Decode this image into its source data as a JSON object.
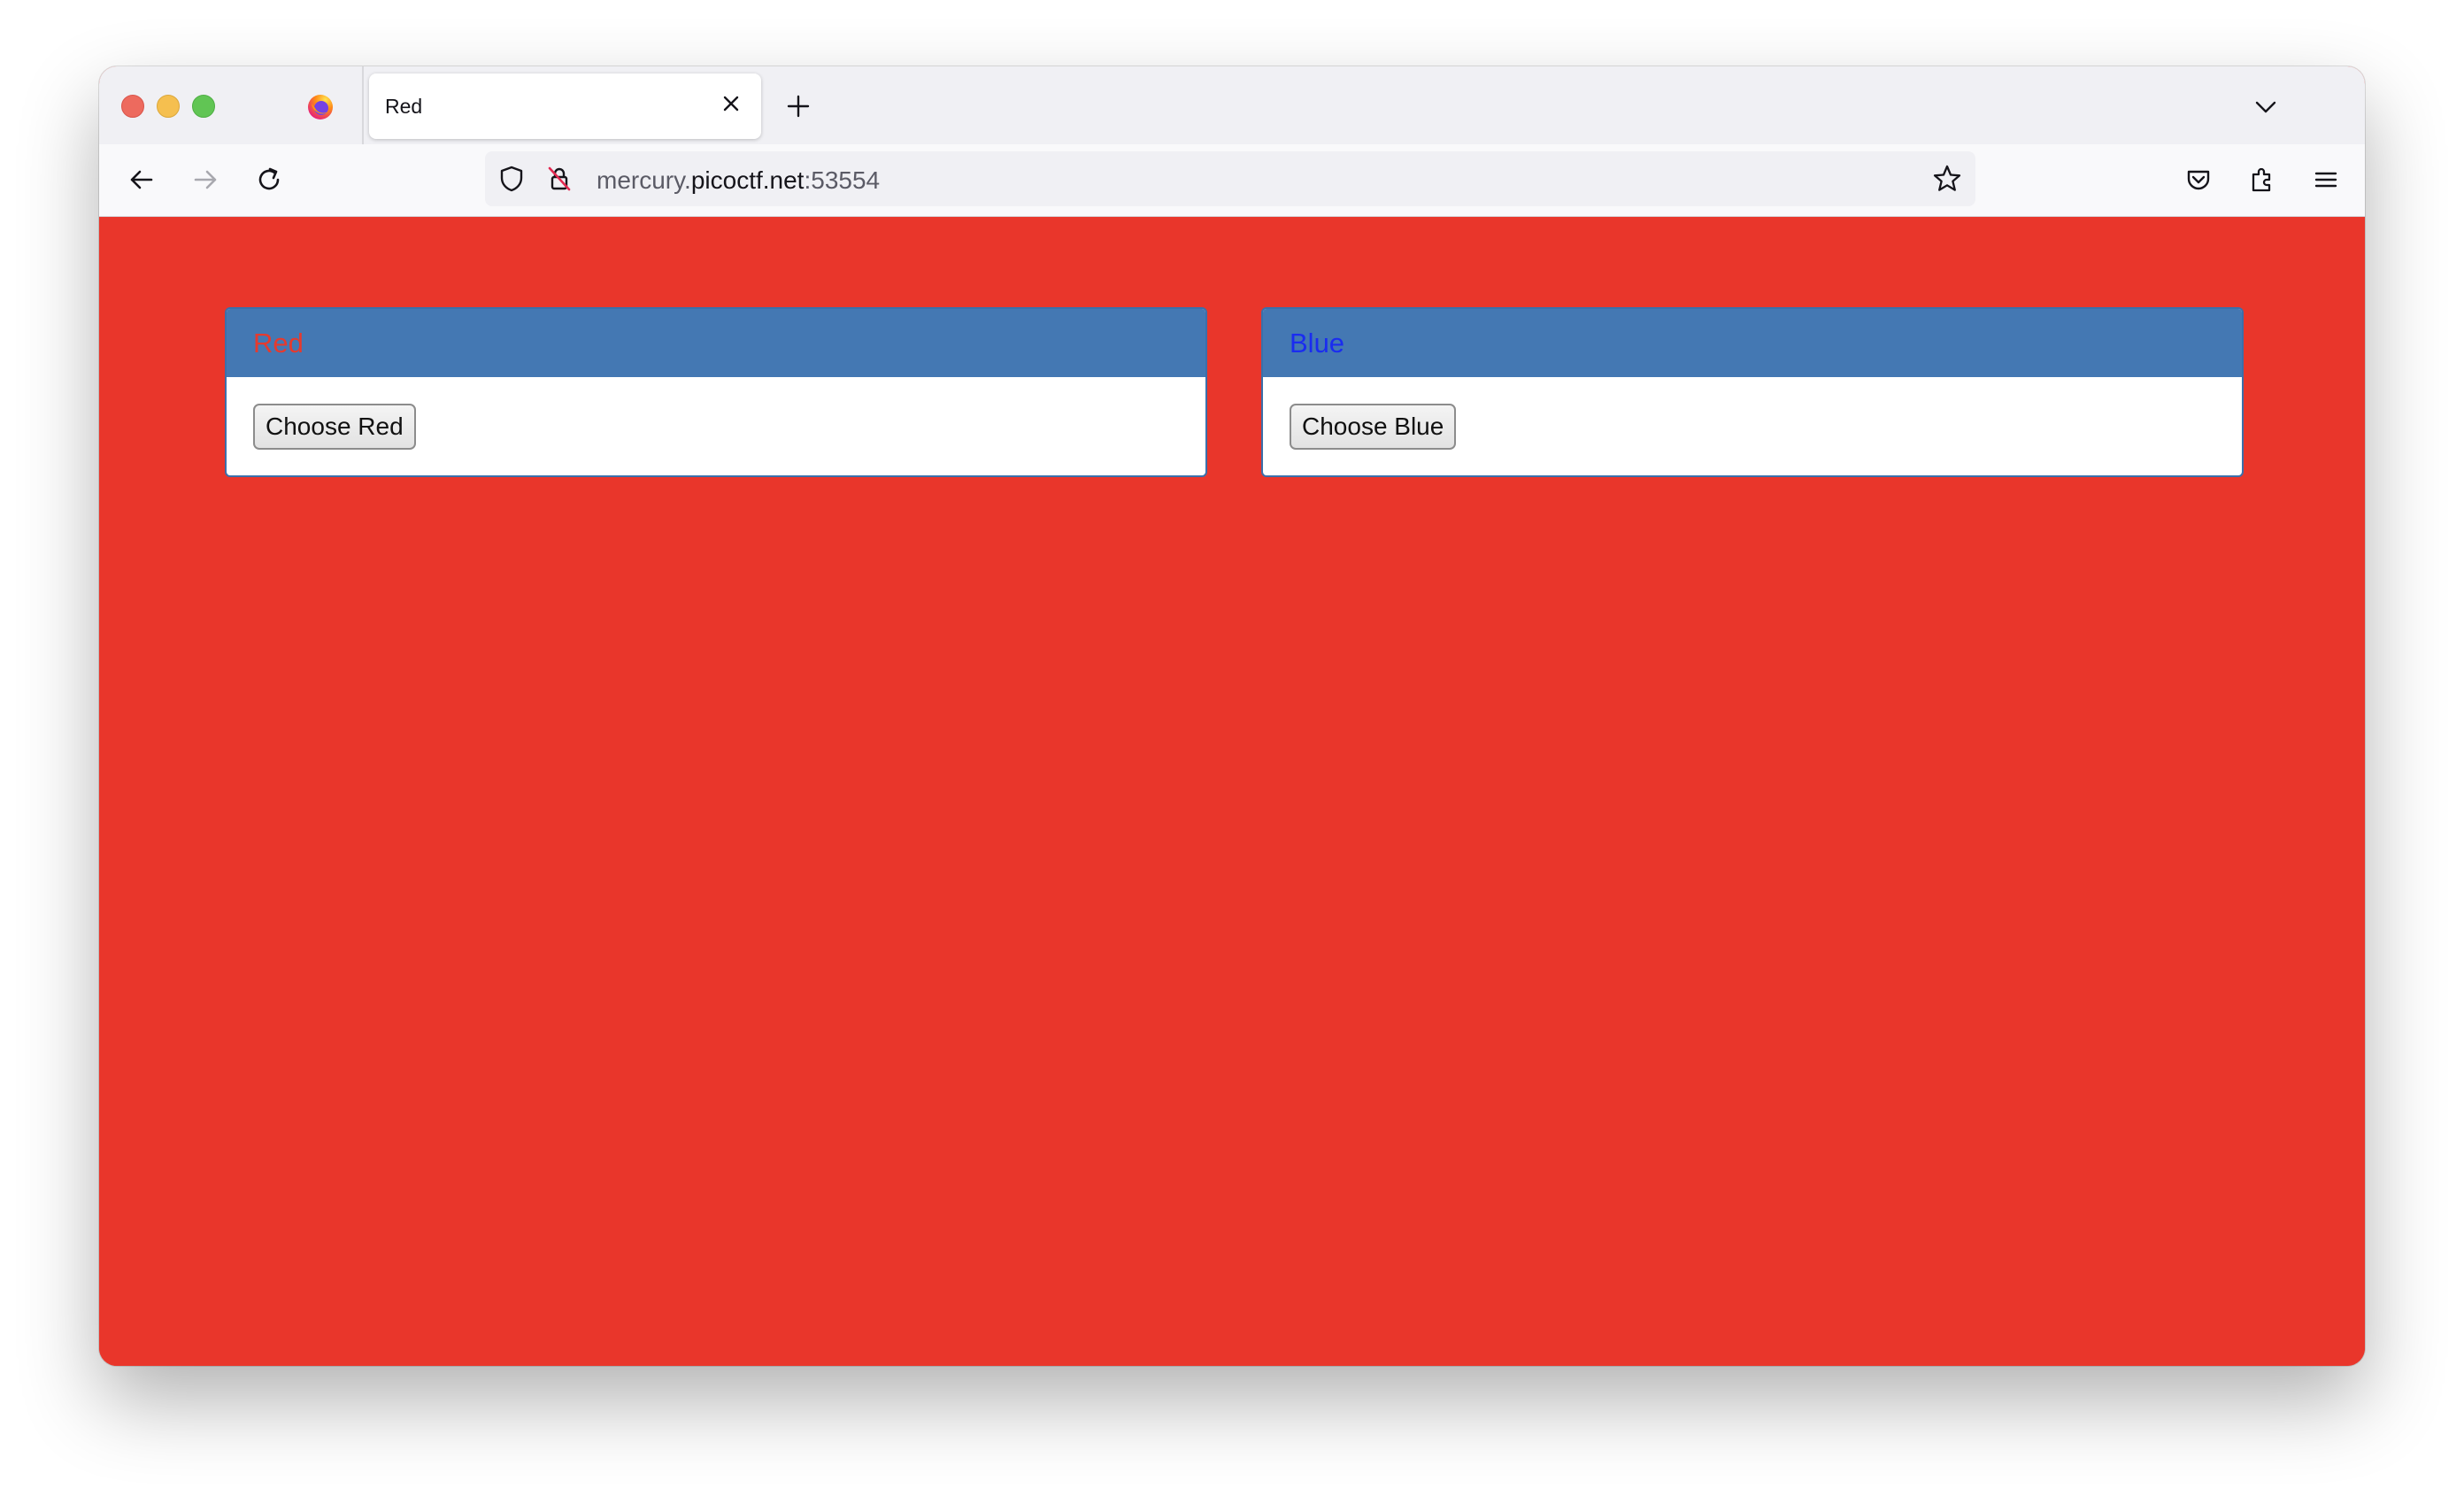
{
  "browser": {
    "tab": {
      "title": "Red"
    },
    "url": {
      "prefix": "mercury.",
      "host": "picoctf.net",
      "port": ":53554"
    },
    "icons": {
      "tab_close": "close-icon",
      "new_tab": "plus-icon",
      "tab_list": "chevron-down-icon",
      "back": "arrow-left-icon",
      "forward": "arrow-right-icon",
      "reload": "reload-icon",
      "tracking": "shield-icon",
      "insecure": "lock-insecure-icon",
      "bookmark": "star-icon",
      "pocket": "pocket-icon",
      "extensions": "puzzle-icon",
      "menu": "hamburger-icon"
    }
  },
  "page": {
    "background_color": "#e9362b",
    "panels": [
      {
        "title": "Red",
        "title_color": "#e63a2e",
        "button_label": "Choose Red"
      },
      {
        "title": "Blue",
        "title_color": "#1a2cf0",
        "button_label": "Choose Blue"
      }
    ],
    "header_color": "#4478b3"
  }
}
